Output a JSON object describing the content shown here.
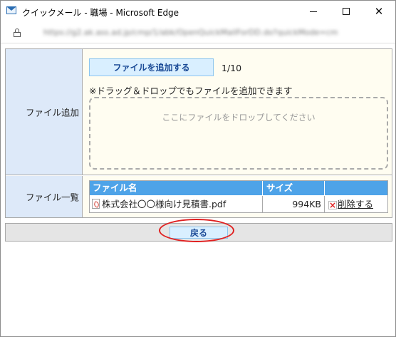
{
  "window": {
    "title": "クイックメール - 職場 - Microsoft Edge",
    "minimize_label": "─",
    "maximize_label": "☐",
    "close_label": "✕"
  },
  "address": {
    "url": "https://g2.ak.ass.ad.jp/cmp/1/abk/OpenQuickMailForDD.do?quickMode=cm"
  },
  "upload_form": {
    "add_label": "ファイル追加",
    "add_button_label": "ファイルを追加する",
    "count_text": "1/10",
    "note_text": "※ドラッグ＆ドロップでもファイルを追加できます",
    "drop_zone_text": "ここにファイルをドロップしてください",
    "list_label": "ファイル一覧",
    "columns": [
      "ファイル名",
      "サイズ",
      ""
    ],
    "files": [
      {
        "name": "株式会社〇〇様向け見積書.pdf",
        "size": "994KB",
        "action": "削除する"
      }
    ]
  },
  "footer": {
    "back_button_label": "戻る"
  },
  "colors": {
    "label_bg": "#dde9f9",
    "value_bg": "#fffdf1",
    "button_bg": "#d9efff",
    "button_text": "#1a4a96",
    "table_header": "#4ea3e8",
    "highlight": "#e02020"
  }
}
